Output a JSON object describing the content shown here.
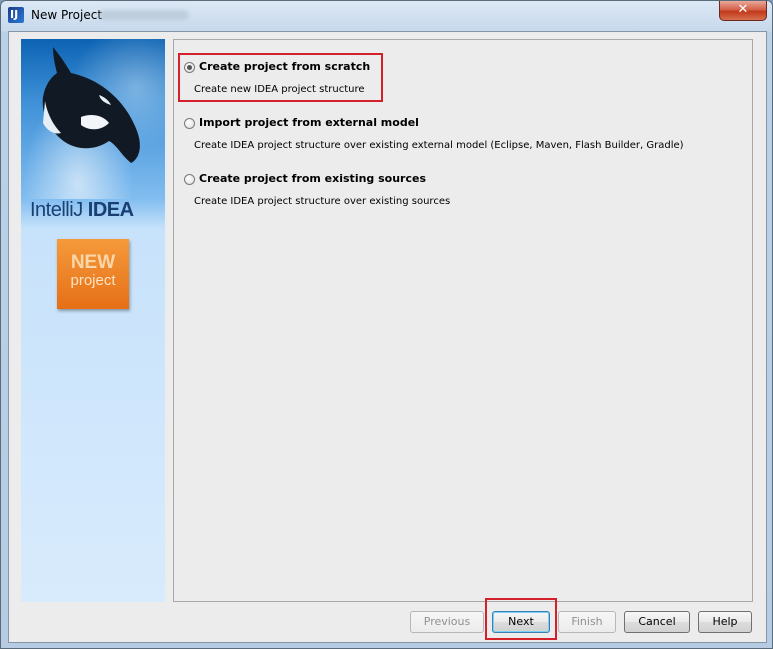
{
  "window": {
    "title": "New Project",
    "close_glyph": "✕",
    "app_icon": "intellij-app-icon"
  },
  "sidebar": {
    "brand_light": "IntelliJ",
    "brand_bold": "IDEA",
    "badge_line1": "NEW",
    "badge_line2": "project"
  },
  "options": [
    {
      "label": "Create project from scratch",
      "description": "Create new IDEA project structure",
      "selected": true
    },
    {
      "label": "Import project from external model",
      "description": "Create IDEA project structure over existing external model (Eclipse, Maven, Flash Builder, Gradle)",
      "selected": false
    },
    {
      "label": "Create project from existing sources",
      "description": "Create IDEA project structure over existing sources",
      "selected": false
    }
  ],
  "buttons": {
    "previous": "Previous",
    "next": "Next",
    "finish": "Finish",
    "cancel": "Cancel",
    "help": "Help"
  },
  "colors": {
    "highlight": "#d4202a",
    "badge": "#f0882c"
  }
}
